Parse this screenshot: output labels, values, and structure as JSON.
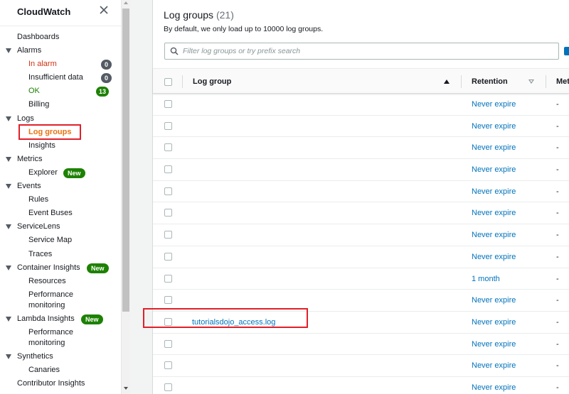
{
  "sidebar": {
    "title": "CloudWatch",
    "items": [
      {
        "label": "Dashboards",
        "level": 0
      },
      {
        "label": "Alarms",
        "level": 0,
        "caret": true
      },
      {
        "label": "In alarm",
        "level": 1,
        "style": "red",
        "badge": "0",
        "badge_style": "grey"
      },
      {
        "label": "Insufficient data",
        "level": 1,
        "badge": "0",
        "badge_style": "grey"
      },
      {
        "label": "OK",
        "level": 1,
        "style": "green",
        "badge": "13",
        "badge_style": "green"
      },
      {
        "label": "Billing",
        "level": 1
      },
      {
        "label": "Logs",
        "level": 0,
        "caret": true
      },
      {
        "label": "Log groups",
        "level": 1,
        "style": "orange",
        "active": true
      },
      {
        "label": "Insights",
        "level": 1
      },
      {
        "label": "Metrics",
        "level": 0,
        "caret": true
      },
      {
        "label": "Explorer",
        "level": 1,
        "badge": "New",
        "badge_style": "new"
      },
      {
        "label": "Events",
        "level": 0,
        "caret": true
      },
      {
        "label": "Rules",
        "level": 1
      },
      {
        "label": "Event Buses",
        "level": 1
      },
      {
        "label": "ServiceLens",
        "level": 0,
        "caret": true
      },
      {
        "label": "Service Map",
        "level": 1
      },
      {
        "label": "Traces",
        "level": 1
      },
      {
        "label": "Container Insights",
        "level": 0,
        "caret": true,
        "badge": "New",
        "badge_style": "new"
      },
      {
        "label": "Resources",
        "level": 1
      },
      {
        "label": "Performance\nmonitoring",
        "level": 1,
        "twoline": true
      },
      {
        "label": "Lambda Insights",
        "level": 0,
        "caret": true,
        "badge": "New",
        "badge_style": "new"
      },
      {
        "label": "Performance\nmonitoring",
        "level": 1,
        "twoline": true
      },
      {
        "label": "Synthetics",
        "level": 0,
        "caret": true
      },
      {
        "label": "Canaries",
        "level": 1
      },
      {
        "label": "Contributor Insights",
        "level": 0
      }
    ]
  },
  "panel": {
    "title": "Log groups",
    "count": "(21)",
    "description": "By default, we only load up to 10000 log groups.",
    "search_placeholder": "Filter log groups or try prefix search",
    "columns": {
      "log_group": "Log group",
      "retention": "Retention",
      "metric": "Met"
    }
  },
  "rows": [
    {
      "name": "",
      "retention": "Never expire",
      "metric": "-"
    },
    {
      "name": "",
      "retention": "Never expire",
      "metric": "-"
    },
    {
      "name": "",
      "retention": "Never expire",
      "metric": "-"
    },
    {
      "name": "",
      "retention": "Never expire",
      "metric": "-"
    },
    {
      "name": "",
      "retention": "Never expire",
      "metric": "-"
    },
    {
      "name": "",
      "retention": "Never expire",
      "metric": "-"
    },
    {
      "name": "",
      "retention": "Never expire",
      "metric": "-"
    },
    {
      "name": "",
      "retention": "Never expire",
      "metric": "-"
    },
    {
      "name": "",
      "retention": "1 month",
      "metric": "-"
    },
    {
      "name": "",
      "retention": "Never expire",
      "metric": "-"
    },
    {
      "name": "tutorialsdojo_access.log",
      "retention": "Never expire",
      "metric": "-"
    },
    {
      "name": "",
      "retention": "Never expire",
      "metric": "-"
    },
    {
      "name": "",
      "retention": "Never expire",
      "metric": "-"
    },
    {
      "name": "",
      "retention": "Never expire",
      "metric": "-"
    }
  ],
  "colors": {
    "accent": "#0073bb",
    "active_nav": "#ec7211",
    "highlight": "#e0202a",
    "alarm": "#d13212",
    "ok": "#1d8102"
  }
}
